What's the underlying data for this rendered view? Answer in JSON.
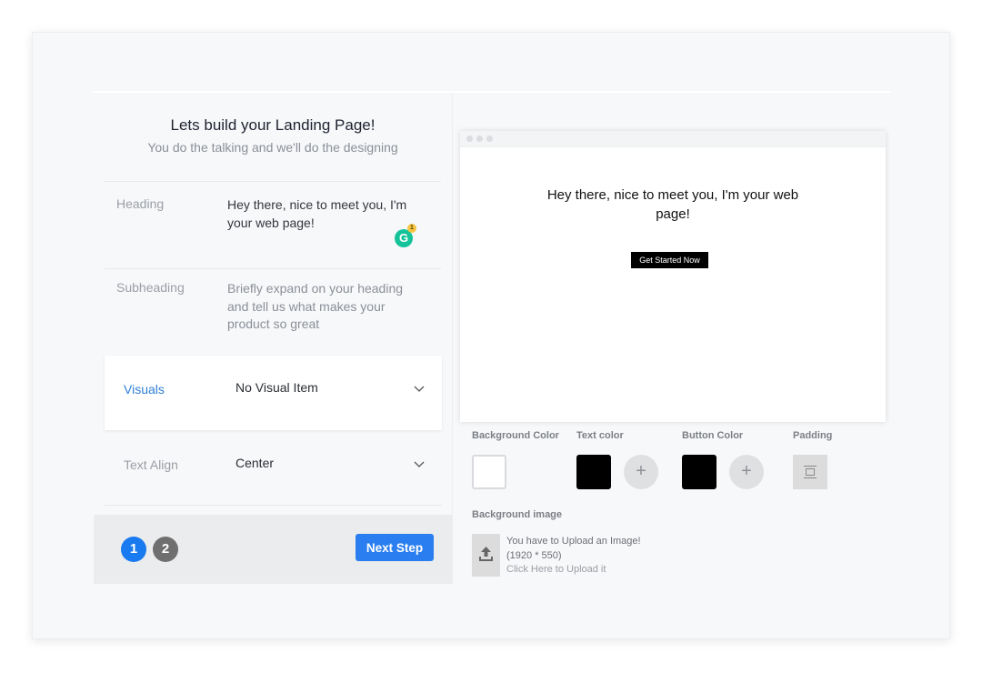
{
  "intro": {
    "title": "Lets build your Landing Page!",
    "subtitle": "You do the talking and we'll do the designing"
  },
  "fields": {
    "heading": {
      "label": "Heading",
      "value": "Hey there, nice to meet you, I'm your web page!",
      "grammarly_count": "1"
    },
    "subheading": {
      "label": "Subheading",
      "placeholder": "Briefly expand on your heading and tell us what makes your product so great"
    },
    "visuals": {
      "label": "Visuals",
      "selected": "No Visual Item"
    },
    "text_align": {
      "label": "Text Align",
      "selected": "Center"
    }
  },
  "steps": {
    "items": [
      "1",
      "2"
    ],
    "current": "1",
    "next_label": "Next Step"
  },
  "preview": {
    "heading": "Hey there, nice to meet you, I'm your web page!",
    "cta_label": "Get Started Now"
  },
  "controls": {
    "background_color": {
      "label": "Background Color",
      "value": "#ffffff"
    },
    "text_color": {
      "label": "Text color",
      "value": "#000000"
    },
    "button_color": {
      "label": "Button Color",
      "value": "#000000"
    },
    "padding": {
      "label": "Padding"
    },
    "add_symbol": "+"
  },
  "background_image": {
    "label": "Background image",
    "line1": "You have to Upload an Image!",
    "line2": "(1920 * 550)",
    "line3": "Click Here to Upload it"
  },
  "colors": {
    "accent": "#2a7ef0",
    "step_active": "#1a7af0",
    "step_inactive": "#6f6f6f",
    "visuals_label": "#2f7fd6",
    "grammarly": "#15c39a"
  }
}
